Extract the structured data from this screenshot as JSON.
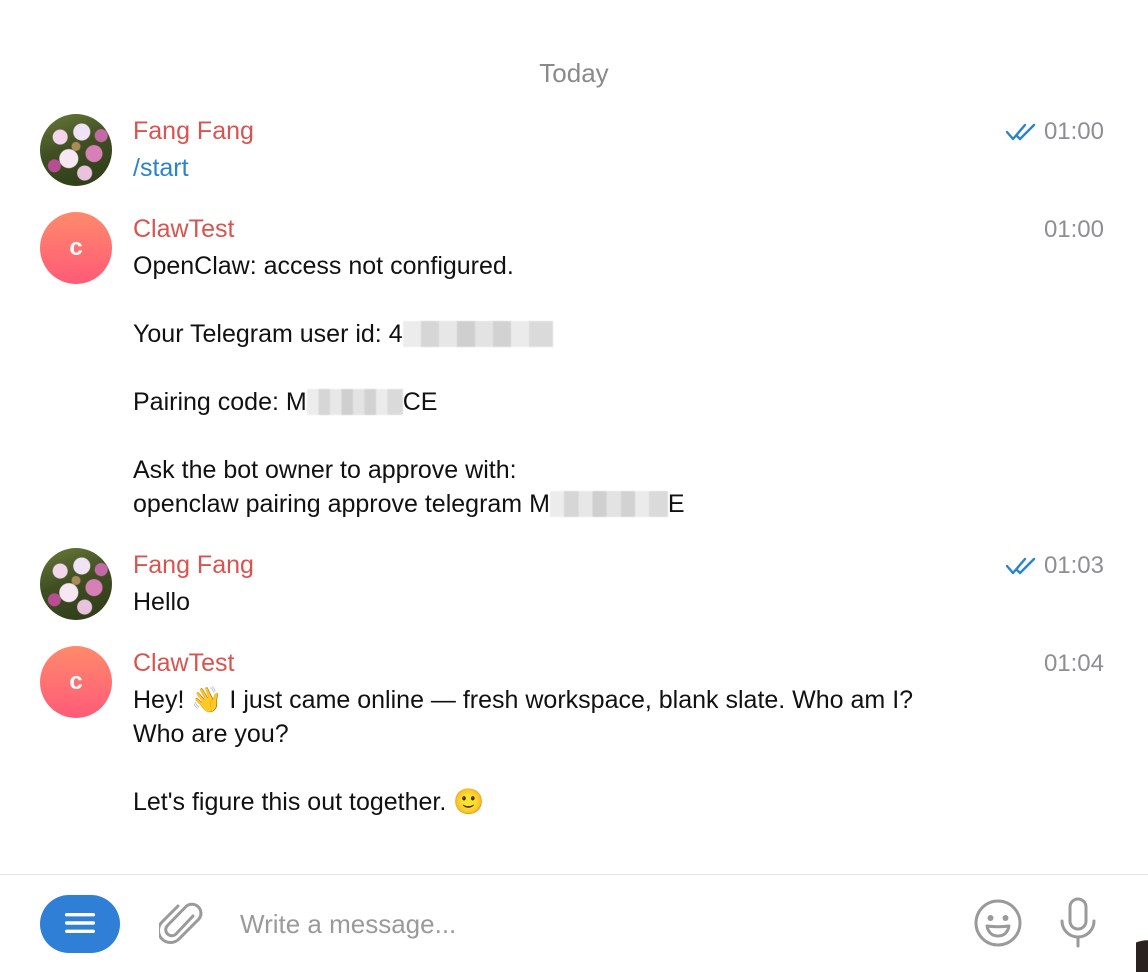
{
  "date_separator": "Today",
  "messages": [
    {
      "sender": "Fang Fang",
      "time": "01:00",
      "read": true,
      "avatar": "flower-photo",
      "text": "/start"
    },
    {
      "sender": "ClawTest",
      "time": "01:00",
      "avatar_letter": "c",
      "line1": "OpenClaw: access not configured.",
      "user_id_prefix": "Your Telegram user id: 4",
      "pairing_prefix": "Pairing code: M",
      "pairing_suffix": "CE",
      "approve_line": "Ask the bot owner to approve with:",
      "command_prefix": "openclaw pairing approve telegram M",
      "command_suffix": "E"
    },
    {
      "sender": "Fang Fang",
      "time": "01:03",
      "read": true,
      "avatar": "flower-photo",
      "text": "Hello"
    },
    {
      "sender": "ClawTest",
      "time": "01:04",
      "avatar_letter": "c",
      "text": "Hey! 👋 I just came online — fresh workspace, blank slate. Who am I? Who are you?\n\nLet's figure this out together. 🙂"
    }
  ],
  "composer": {
    "placeholder": "Write a message..."
  },
  "icons": {
    "menu": "menu-icon",
    "attach": "paperclip-icon",
    "emoji": "smiley-icon",
    "mic": "microphone-icon",
    "read": "double-check-icon"
  },
  "colors": {
    "sender_name": "#d9534f",
    "command_link": "#2a84c8",
    "read_check": "#2a84c8",
    "timestamp": "#8e8e93",
    "menu_button": "#2f7fd6",
    "bot_avatar": "#ff6f72"
  }
}
